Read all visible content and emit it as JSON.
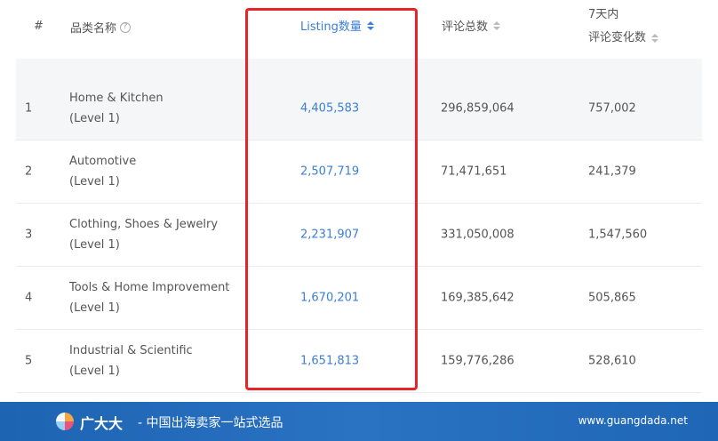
{
  "header": {
    "rank": "#",
    "name": "品类名称",
    "listing": "Listing数量",
    "reviews": "评论总数",
    "change_line1": "7天内",
    "change_line2": "评论变化数"
  },
  "rows": [
    {
      "rank": "1",
      "name": "Home & Kitchen",
      "level": "(Level 1)",
      "listing": "4,405,583",
      "reviews": "296,859,064",
      "change": "757,002"
    },
    {
      "rank": "2",
      "name": "Automotive",
      "level": "(Level 1)",
      "listing": "2,507,719",
      "reviews": "71,471,651",
      "change": "241,379"
    },
    {
      "rank": "3",
      "name": "Clothing, Shoes & Jewelry",
      "level": "(Level 1)",
      "listing": "2,231,907",
      "reviews": "331,050,008",
      "change": "1,547,560"
    },
    {
      "rank": "4",
      "name": "Tools & Home Improvement",
      "level": "(Level 1)",
      "listing": "1,670,201",
      "reviews": "169,385,642",
      "change": "505,865"
    },
    {
      "rank": "5",
      "name": "Industrial & Scientific",
      "level": "(Level 1)",
      "listing": "1,651,813",
      "reviews": "159,776,286",
      "change": "528,610"
    }
  ],
  "footer": {
    "brand": "广大大",
    "slogan": "- 中国出海卖家一站式选品",
    "site": "www.guangdada.net"
  },
  "colors": {
    "accent": "#3b7fd4",
    "highlight": "#e8242a",
    "footer_bg": "#1f66b6"
  },
  "icons": {
    "help": "help-circle-icon",
    "sort": "sort-icon",
    "logo": "pie-logo-icon"
  }
}
